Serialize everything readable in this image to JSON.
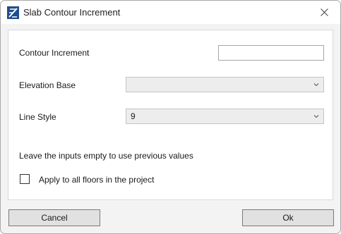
{
  "window": {
    "title": "Slab Contour Increment",
    "close_icon": "close-icon",
    "app_icon": "app-logo-icon"
  },
  "form": {
    "contour_increment_label": "Contour Increment",
    "contour_increment_value": "",
    "elevation_base_label": "Elevation Base",
    "elevation_base_value": "",
    "line_style_label": "Line Style",
    "line_style_value": "9",
    "hint": "Leave the inputs empty to use previous values",
    "apply_all_label": "Apply to all floors in the project",
    "apply_all_checked": false
  },
  "buttons": {
    "cancel_label": "Cancel",
    "ok_label": "Ok"
  },
  "colors": {
    "dialog_background": "#f3f3f3",
    "panel_background": "#ffffff",
    "button_background": "#e1e1e1",
    "combo_background": "#ededed",
    "icon_blue": "#1f4e8c"
  }
}
